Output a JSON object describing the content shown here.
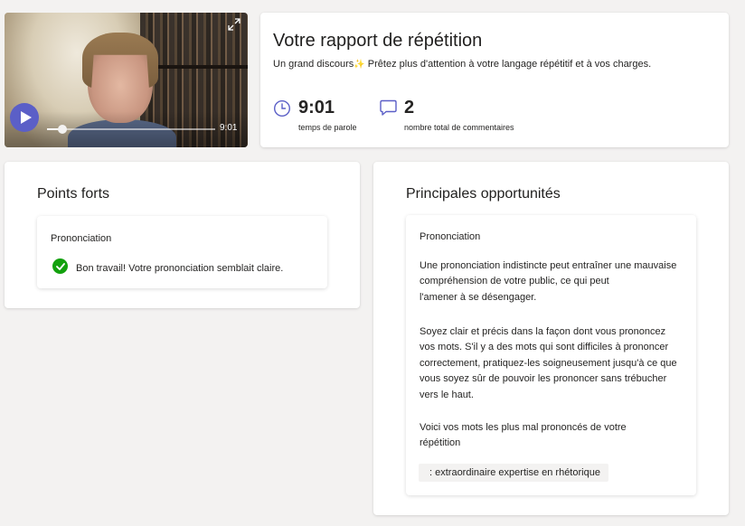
{
  "video": {
    "duration": "9:01",
    "progress": 0.09
  },
  "report": {
    "title": "Votre rapport de répétition",
    "subtitle_prefix": "Un grand discours",
    "subtitle_rest": " Prêtez plus d'attention à votre langage répétitif et à vos charges.",
    "stats": {
      "speaking_time": {
        "value": "9:01",
        "label": "temps de parole",
        "icon": "clock-icon"
      },
      "comments": {
        "value": "2",
        "label": "nombre total de commentaires",
        "icon": "comment-icon"
      }
    }
  },
  "strengths": {
    "title": "Points forts",
    "card": {
      "title": "Prononciation",
      "message": "Bon travail! Votre prononciation semblait claire."
    }
  },
  "opportunities": {
    "title": "Principales opportunités",
    "card": {
      "title": "Prononciation",
      "p1_line1": "Une prononciation indistincte peut entraîner une mauvaise",
      "p1_line2": "compréhension de votre public, ce qui peut",
      "p1_line3": "l'amener à se désengager.",
      "p2_line1": "Soyez clair et précis dans la façon dont vous prononcez",
      "p2_line2": "vos mots. S'il y a des mots qui sont difficiles à prononcer",
      "p2_line3": "correctement, pratiquez-les soigneusement jusqu'à ce que",
      "p2_line4": "vous soyez sûr de pouvoir les prononcer sans trébucher",
      "p2_line5": "vers le haut.",
      "p3_line1": "Voici vos mots les plus mal prononcés de votre",
      "p3_line2": "répétition",
      "words": ": extraordinaire expertise en rhétorique"
    }
  },
  "colors": {
    "accent": "#5b5fc7",
    "success": "#13a10e",
    "background": "#f3f2f1"
  }
}
